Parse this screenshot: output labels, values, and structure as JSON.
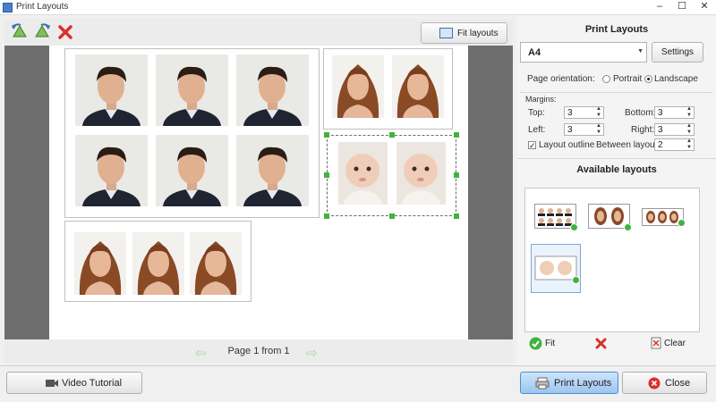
{
  "window": {
    "title": "Print Layouts"
  },
  "toolbar": {
    "fit_layouts_label": "Fit layouts"
  },
  "page_nav": {
    "text": "Page 1 from 1"
  },
  "bottom": {
    "video_tutorial_label": "Video Tutorial",
    "print_layouts_label": "Print Layouts",
    "close_label": "Close"
  },
  "panel": {
    "title": "Print Layouts",
    "paper_size": "A4",
    "settings_label": "Settings",
    "page_orientation_label": "Page orientation:",
    "portrait_label": "Portrait",
    "landscape_label": "Landscape",
    "orientation_selected": "Landscape",
    "margins_label": "Margins:",
    "top_label": "Top:",
    "top_value": "3",
    "bottom_label": "Bottom:",
    "bottom_value": "3",
    "left_label": "Left:",
    "left_value": "3",
    "right_label": "Right:",
    "right_value": "3",
    "layout_outline_label": "Layout outline",
    "layout_outline_checked": true,
    "between_layouts_label": "Between layouts:",
    "between_layouts_value": "2",
    "available_layouts_title": "Available layouts",
    "fit_label": "Fit",
    "clear_label": "Clear"
  },
  "colors": {
    "accent": "#5aa0e6",
    "canvas_bg": "#6e6e6e",
    "selection_handle": "#3fb33f",
    "remove_red": "#d9302c"
  }
}
